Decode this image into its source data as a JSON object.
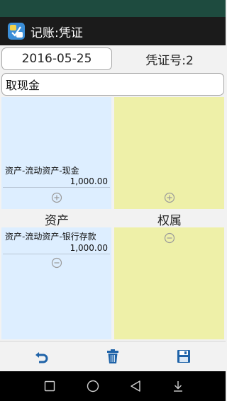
{
  "header": {
    "title": "记账:凭证",
    "icon": "app-ledger-icon"
  },
  "voucher": {
    "date": "2016-05-25",
    "number_label": "凭证号:2",
    "memo": "取现金"
  },
  "debit": {
    "entries": [
      {
        "account": "资产-流动资产-现金",
        "amount": "1,000.00"
      }
    ],
    "add_icon": "circle-plus-icon"
  },
  "credit": {
    "entries": [],
    "add_icon": "circle-plus-icon"
  },
  "assets_section": {
    "label": "资产",
    "entries": [
      {
        "account": "资产-流动资产-银行存款",
        "amount": "1,000.00"
      }
    ],
    "remove_icon": "circle-minus-icon"
  },
  "equity_section": {
    "label": "权属",
    "remove_icon": "circle-minus-icon"
  },
  "toolbar": {
    "undo_icon": "undo-icon",
    "delete_icon": "trash-icon",
    "save_icon": "save-icon"
  },
  "colors": {
    "accent": "#1f63a8",
    "blue_panel": "#ddeeff",
    "yellow_panel": "#eef0a8",
    "title_bar": "#1b1b1b",
    "status_bar": "#1e4b3f"
  }
}
